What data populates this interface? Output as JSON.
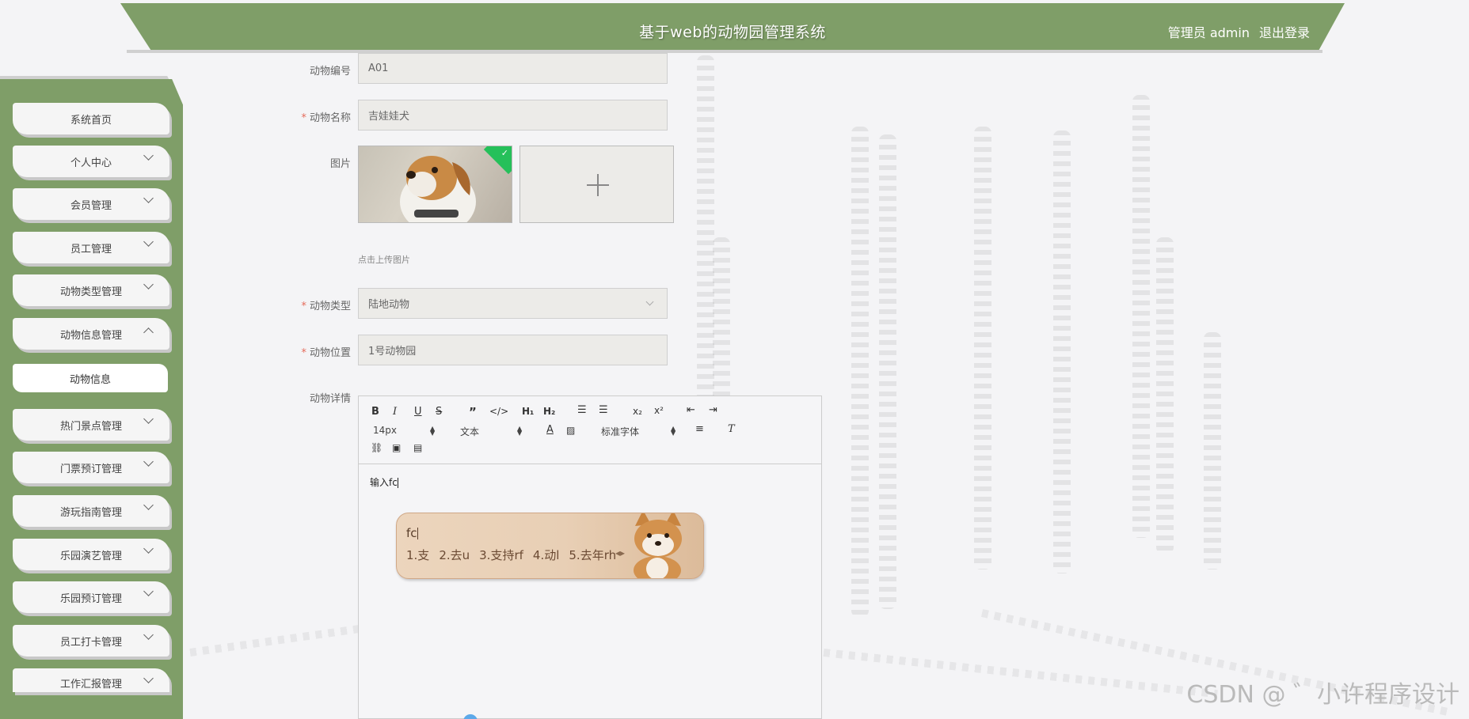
{
  "header": {
    "title": "基于web的动物园管理系统",
    "user_label": "管理员 admin",
    "logout_label": "退出登录"
  },
  "sidebar": {
    "items": [
      {
        "label": "系统首页"
      },
      {
        "label": "个人中心"
      },
      {
        "label": "会员管理"
      },
      {
        "label": "员工管理"
      },
      {
        "label": "动物类型管理"
      },
      {
        "label": "动物信息管理"
      },
      {
        "label": "热门景点管理"
      },
      {
        "label": "门票预订管理"
      },
      {
        "label": "游玩指南管理"
      },
      {
        "label": "乐园演艺管理"
      },
      {
        "label": "乐园预订管理"
      },
      {
        "label": "员工打卡管理"
      },
      {
        "label": "工作汇报管理"
      }
    ],
    "submenu": {
      "label": "动物信息"
    }
  },
  "form": {
    "animal_no": {
      "label": "动物编号",
      "value": "A01"
    },
    "animal_name": {
      "label": "动物名称",
      "value": "吉娃娃犬"
    },
    "image": {
      "label": "图片",
      "hint": "点击上传图片"
    },
    "animal_type": {
      "label": "动物类型",
      "value": "陆地动物"
    },
    "animal_location": {
      "label": "动物位置",
      "value": "1号动物园"
    },
    "animal_detail": {
      "label": "动物详情"
    }
  },
  "editor": {
    "font_size": "14px",
    "paragraph": "文本",
    "font_family": "标准字体",
    "content": "输入fc"
  },
  "ime": {
    "input": "fc",
    "candidates": [
      "1.支",
      "2.去u",
      "3.支持rf",
      "4.动l",
      "5.去年rh"
    ]
  },
  "watermark": "CSDN @ ゛小许程序设计"
}
